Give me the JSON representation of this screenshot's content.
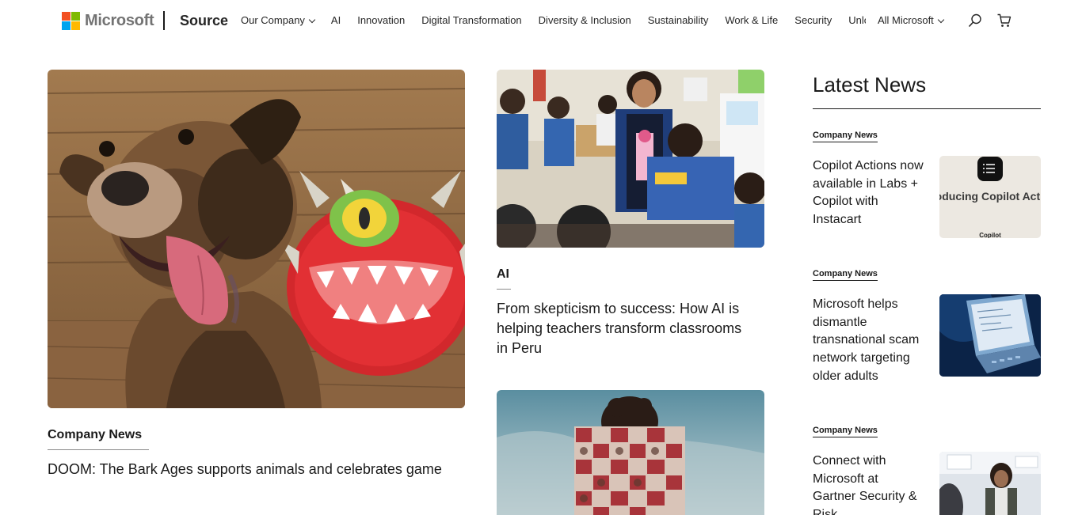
{
  "header": {
    "brand": "Microsoft",
    "site_title": "Source",
    "nav": [
      {
        "label": "Our Company",
        "dropdown": true
      },
      {
        "label": "AI",
        "dropdown": false
      },
      {
        "label": "Innovation",
        "dropdown": false
      },
      {
        "label": "Digital Transformation",
        "dropdown": false
      },
      {
        "label": "Diversity & Inclusion",
        "dropdown": false
      },
      {
        "label": "Sustainability",
        "dropdown": false
      },
      {
        "label": "Work & Life",
        "dropdown": false
      },
      {
        "label": "Security",
        "dropdown": false
      },
      {
        "label": "Unlo",
        "dropdown": false
      }
    ],
    "all_microsoft": "All Microsoft",
    "icons": [
      "search-icon",
      "cart-icon"
    ],
    "logo_colors": [
      "#f25022",
      "#7fba00",
      "#00a4ef",
      "#ffb900"
    ]
  },
  "main": {
    "feature": {
      "tag": "Company News",
      "headline": "DOOM: The Bark Ages supports animals and celebrates game"
    },
    "ai_story": {
      "tag": "AI",
      "headline": "From skepticism to success: How AI is helping teachers transform classrooms in Peru"
    }
  },
  "sidebar": {
    "title": "Latest News",
    "items": [
      {
        "tag": "Company News",
        "headline": "Copilot Actions now available in Labs + Copilot with Instacart",
        "thumb_title": "Introducing Copilot Actions",
        "thumb_caption": "Copilot"
      },
      {
        "tag": "Company News",
        "headline": "Microsoft helps dismantle transnational scam network targeting older adults"
      },
      {
        "tag": "Company News",
        "headline": "Connect with Microsoft at Gartner Security & Risk"
      }
    ]
  }
}
